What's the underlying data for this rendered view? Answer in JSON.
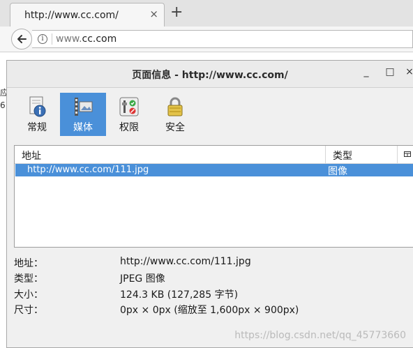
{
  "browser": {
    "tab_title": "http://www.cc.com/",
    "tab_close": "×",
    "new_tab": "+",
    "url_prefix": "www.",
    "url_main": "cc.com"
  },
  "side_fragment": [
    "应",
    "6"
  ],
  "dialog": {
    "title": "页面信息 - http://www.cc.com/",
    "win_minimize": "_",
    "win_maximize": "□",
    "win_close": "×",
    "toolbar": [
      {
        "label": "常规",
        "icon": "general-info-icon",
        "selected": false
      },
      {
        "label": "媒体",
        "icon": "media-icon",
        "selected": true
      },
      {
        "label": "权限",
        "icon": "permissions-icon",
        "selected": false
      },
      {
        "label": "安全",
        "icon": "security-lock-icon",
        "selected": false
      }
    ],
    "list": {
      "columns": [
        "地址",
        "类型"
      ],
      "rows": [
        {
          "address": "http://www.cc.com/111.jpg",
          "type": "图像",
          "selected": true
        }
      ]
    },
    "details": [
      {
        "label": "地址：",
        "value": "http://www.cc.com/111.jpg"
      },
      {
        "label": "类型：",
        "value": "JPEG 图像"
      },
      {
        "label": "大小：",
        "value": "124.3 KB (127,285 字节)"
      },
      {
        "label": "尺寸：",
        "value": "0px × 0px (缩放至 1,600px × 900px)"
      }
    ]
  },
  "watermark": "https://blog.csdn.net/qq_45773660",
  "colors": {
    "selection": "#4a90d9"
  }
}
